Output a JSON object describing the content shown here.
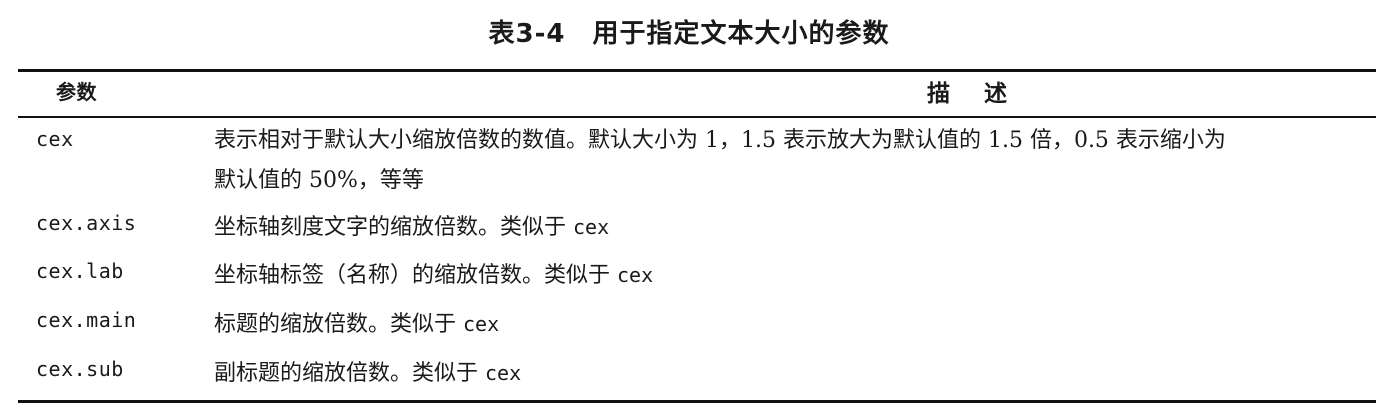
{
  "caption": "表3-4　用于指定文本大小的参数",
  "header": {
    "param": "参数",
    "desc": "描述"
  },
  "rows": [
    {
      "param": "cex",
      "desc_line1": "表示相对于默认大小缩放倍数的数值。默认大小为 1，1.5 表示放大为默认值的 1.5 倍，0.5 表示缩小为",
      "desc_line2": "默认值的 50%，等等"
    },
    {
      "param": "cex.axis",
      "desc": "坐标轴刻度文字的缩放倍数。类似于 ",
      "code": "cex"
    },
    {
      "param": "cex.lab",
      "desc": "坐标轴标签（名称）的缩放倍数。类似于 ",
      "code": "cex"
    },
    {
      "param": "cex.main",
      "desc": "标题的缩放倍数。类似于 ",
      "code": "cex"
    },
    {
      "param": "cex.sub",
      "desc": "副标题的缩放倍数。类似于 ",
      "code": "cex"
    }
  ]
}
